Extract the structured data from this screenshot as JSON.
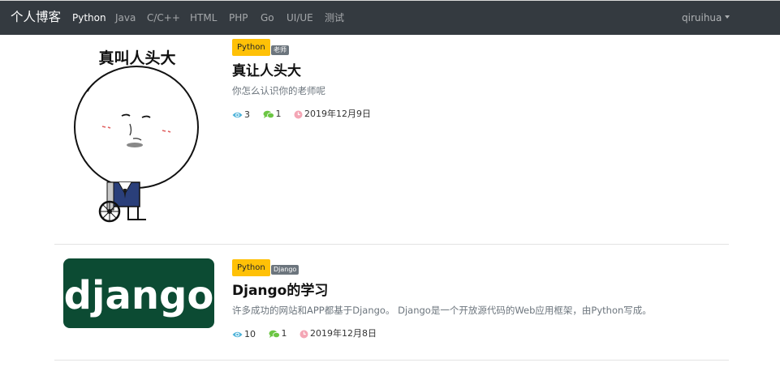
{
  "navbar": {
    "brand": "个人博客",
    "links": [
      "Python",
      "Java",
      "C/C++",
      "HTML",
      "PHP",
      "Go",
      "UI/UE",
      "测试"
    ],
    "active": "Python",
    "user": "qiruihua"
  },
  "articles": [
    {
      "image_text": "真叫人头大",
      "category": "Python",
      "tag": "老师",
      "title": "真让人头大",
      "summary": "你怎么认识你的老师呢",
      "views": "3",
      "comments": "1",
      "date": "2019年12月9日"
    },
    {
      "image_text": "django",
      "category": "Python",
      "tag": "Django",
      "title": "Django的学习",
      "summary": "许多成功的网站和APP都基于Django。 Django是一个开放源代码的Web应用框架，由Python写成。",
      "views": "10",
      "comments": "1",
      "date": "2019年12月8日"
    }
  ],
  "colors": {
    "navbar_bg": "#343a40",
    "category_badge": "#ffc107",
    "tag_badge": "#6c757d",
    "eye_icon": "#4fb3d9",
    "comment_icon": "#6cc644",
    "clock_icon": "#f4a6b5",
    "django_bg": "#0c4b33"
  },
  "icons": [
    "eye-icon",
    "comments-icon",
    "clock-icon",
    "caret-down-icon"
  ]
}
